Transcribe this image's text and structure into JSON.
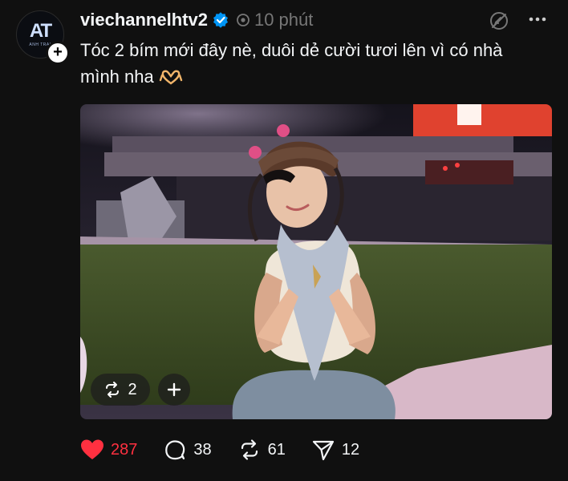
{
  "post": {
    "avatar_text": "AT",
    "avatar_sub": "ANH TRAI",
    "username": "viechannelhtv2",
    "time": "10 phút",
    "caption": "Tóc 2 bím mới đây nè, duôi dẻ cười tươi lên vì có nhà mình nha"
  },
  "media": {
    "repost_count": "2"
  },
  "actions": {
    "likes": "287",
    "replies": "38",
    "reposts": "61",
    "shares": "12"
  },
  "colors": {
    "background": "#101010",
    "like": "#ff3040",
    "verified": "#0095f6",
    "muted": "#777777"
  }
}
